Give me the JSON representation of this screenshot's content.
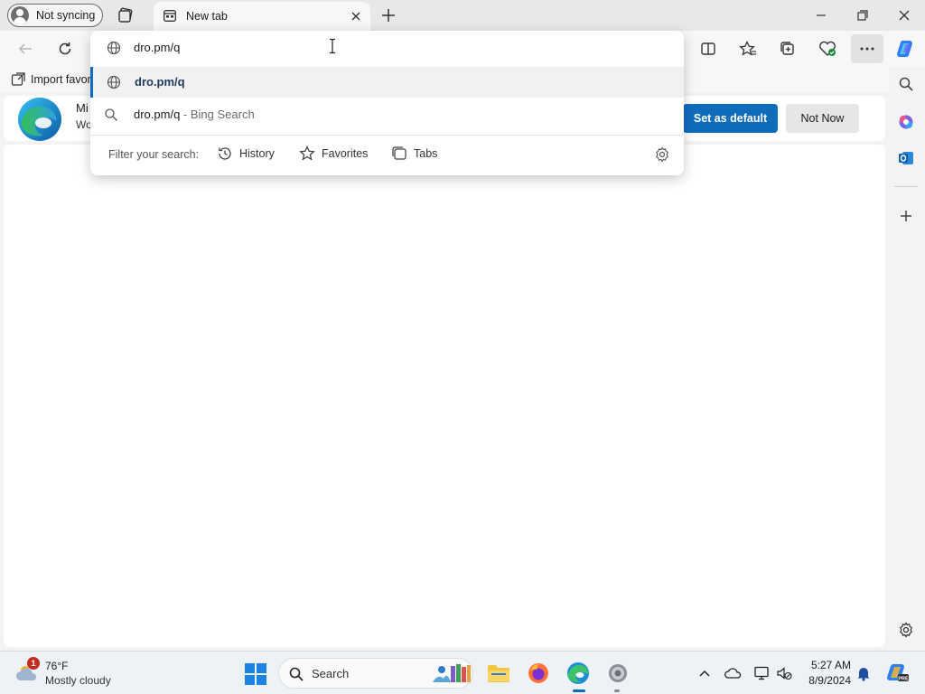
{
  "titlebar": {
    "profile_label": "Not syncing",
    "tab_title": "New tab"
  },
  "favorites_bar": {
    "import_label": "Import favor"
  },
  "banner": {
    "title": "Mi",
    "subtitle": "Wo",
    "set_default_label": "Set as default",
    "not_now_label": "Not Now"
  },
  "omnibox": {
    "input_value": "dro.pm/q",
    "suggestions": [
      {
        "text": "dro.pm/q",
        "suffix": "",
        "icon": "globe-icon"
      },
      {
        "text": "dro.pm/q",
        "suffix": " - Bing Search",
        "icon": "search-icon"
      }
    ],
    "filter_label": "Filter your search:",
    "filters": [
      {
        "label": "History",
        "icon": "history-icon"
      },
      {
        "label": "Favorites",
        "icon": "star-icon"
      },
      {
        "label": "Tabs",
        "icon": "tabs-icon"
      }
    ]
  },
  "taskbar": {
    "weather_temp": "76°F",
    "weather_desc": "Mostly cloudy",
    "weather_badge": "1",
    "search_label": "Search",
    "clock_time": "5:27 AM",
    "clock_date": "8/9/2024"
  },
  "colors": {
    "accent": "#0f6cbd",
    "badge": "#c42b1c"
  }
}
